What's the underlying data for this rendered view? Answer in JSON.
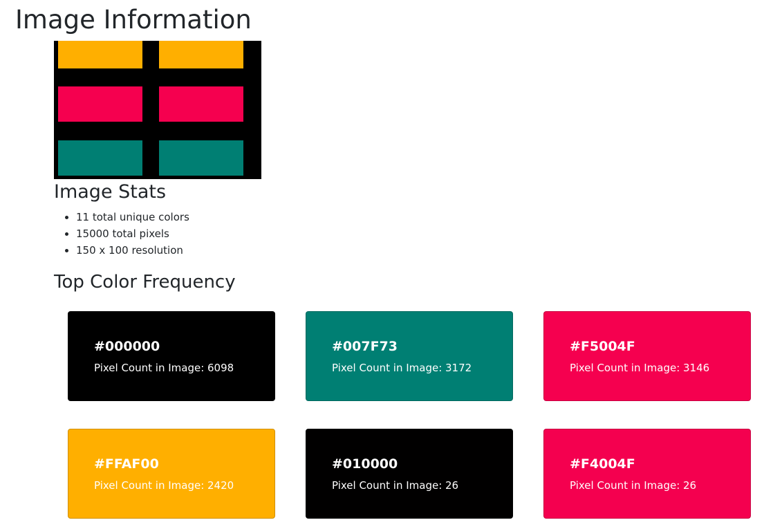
{
  "page": {
    "title": "Image Information"
  },
  "preview_image": {
    "background": "#000000",
    "rows": [
      {
        "color": "#FFAF00"
      },
      {
        "color": "#F5004F"
      },
      {
        "color": "#007F73"
      }
    ]
  },
  "stats": {
    "heading": "Image Stats",
    "items": [
      "11 total unique colors",
      "15000 total pixels",
      "150 x 100 resolution"
    ]
  },
  "frequency": {
    "heading": "Top Color Frequency",
    "count_label": "Pixel Count in Image:",
    "colors": [
      {
        "hex": "#000000",
        "count": 6098,
        "label": "Pixel Count in Image: 6098"
      },
      {
        "hex": "#007F73",
        "count": 3172,
        "label": "Pixel Count in Image: 3172"
      },
      {
        "hex": "#F5004F",
        "count": 3146,
        "label": "Pixel Count in Image: 3146"
      },
      {
        "hex": "#FFAF00",
        "count": 2420,
        "label": "Pixel Count in Image: 2420"
      },
      {
        "hex": "#010000",
        "count": 26,
        "label": "Pixel Count in Image: 26"
      },
      {
        "hex": "#F4004F",
        "count": 26,
        "label": "Pixel Count in Image: 26"
      }
    ]
  }
}
